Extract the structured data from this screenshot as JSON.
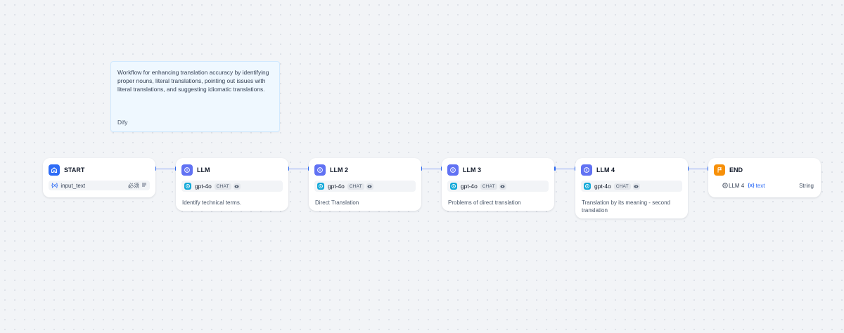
{
  "note": {
    "text": "Workflow for enhancing translation accuracy by identifying proper nouns, literal translations, pointing out issues with literal translations, and suggesting idiomatic translations.",
    "author": "Dify"
  },
  "nodes": {
    "start": {
      "title": "START",
      "icon": "home-icon",
      "variable": {
        "symbol": "{x}",
        "name": "input_text",
        "required": "必须",
        "type_icon": "text-lines-icon"
      }
    },
    "llm1": {
      "title": "LLM",
      "icon": "llm-icon",
      "model": "gpt-4o",
      "chip": "CHAT",
      "description": "Identify technical terms."
    },
    "llm2": {
      "title": "LLM 2",
      "icon": "llm-icon",
      "model": "gpt-4o",
      "chip": "CHAT",
      "description": "Direct Translation"
    },
    "llm3": {
      "title": "LLM 3",
      "icon": "llm-icon",
      "model": "gpt-4o",
      "chip": "CHAT",
      "description": "Problems of direct translation"
    },
    "llm4": {
      "title": "LLM 4",
      "icon": "llm-icon",
      "model": "gpt-4o",
      "chip": "CHAT",
      "description": "Translation by its meaning - second translation"
    },
    "end": {
      "title": "END",
      "icon": "flag-icon",
      "output": {
        "source": "LLM 4",
        "symbol": "{x}",
        "name": "text",
        "type": "String"
      }
    }
  },
  "colors": {
    "start_icon": "#2e6cf6",
    "llm_icon": "#6172f3",
    "end_icon": "#f79009",
    "model_icon": "#10a8d8",
    "connector": "#8ea6f5",
    "handle": "#2e6cf6",
    "note_bg": "#eff8ff"
  }
}
